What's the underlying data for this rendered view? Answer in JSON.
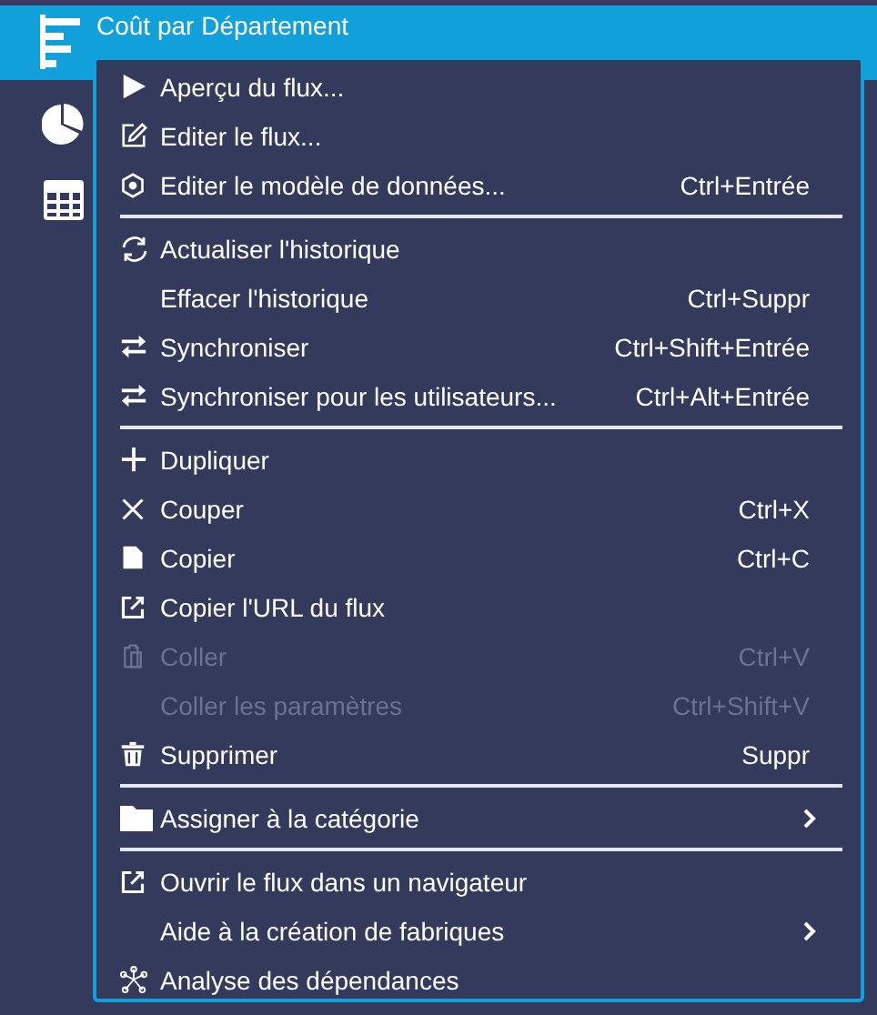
{
  "header": {
    "title": "Coût par Département"
  },
  "menu": [
    {
      "kind": "item",
      "label": "Aperçu du flux...",
      "disabled": false,
      "submenu": false
    },
    {
      "kind": "item",
      "label": "Editer le flux...",
      "disabled": false,
      "submenu": false
    },
    {
      "kind": "item",
      "label": "Editer le modèle de données...",
      "shortcut": "Ctrl+Entrée",
      "disabled": false,
      "submenu": false
    },
    {
      "kind": "separator"
    },
    {
      "kind": "item",
      "label": "Actualiser l'historique",
      "disabled": false,
      "submenu": false
    },
    {
      "kind": "item",
      "label": "Effacer l'historique",
      "shortcut": "Ctrl+Suppr",
      "disabled": false,
      "submenu": false
    },
    {
      "kind": "item",
      "label": "Synchroniser",
      "shortcut": "Ctrl+Shift+Entrée",
      "disabled": false,
      "submenu": false
    },
    {
      "kind": "item",
      "label": "Synchroniser pour les utilisateurs...",
      "shortcut": "Ctrl+Alt+Entrée",
      "disabled": false,
      "submenu": false
    },
    {
      "kind": "separator"
    },
    {
      "kind": "item",
      "label": "Dupliquer",
      "disabled": false,
      "submenu": false
    },
    {
      "kind": "item",
      "label": "Couper",
      "shortcut": "Ctrl+X",
      "disabled": false,
      "submenu": false
    },
    {
      "kind": "item",
      "label": "Copier",
      "shortcut": "Ctrl+C",
      "disabled": false,
      "submenu": false
    },
    {
      "kind": "item",
      "label": "Copier l'URL du flux",
      "disabled": false,
      "submenu": false
    },
    {
      "kind": "item",
      "label": "Coller",
      "shortcut": "Ctrl+V",
      "disabled": true,
      "submenu": false
    },
    {
      "kind": "item",
      "label": "Coller les paramètres",
      "shortcut": "Ctrl+Shift+V",
      "disabled": true,
      "submenu": false
    },
    {
      "kind": "item",
      "label": "Supprimer",
      "shortcut": "Suppr",
      "disabled": false,
      "submenu": false
    },
    {
      "kind": "separator"
    },
    {
      "kind": "item",
      "label": "Assigner à la catégorie",
      "disabled": false,
      "submenu": true
    },
    {
      "kind": "separator"
    },
    {
      "kind": "item",
      "label": "Ouvrir le flux dans un navigateur",
      "disabled": false,
      "submenu": false
    },
    {
      "kind": "item",
      "label": "Aide à la création de fabriques",
      "disabled": false,
      "submenu": true
    },
    {
      "kind": "item",
      "label": "Analyse des dépendances",
      "disabled": false,
      "submenu": false
    }
  ]
}
